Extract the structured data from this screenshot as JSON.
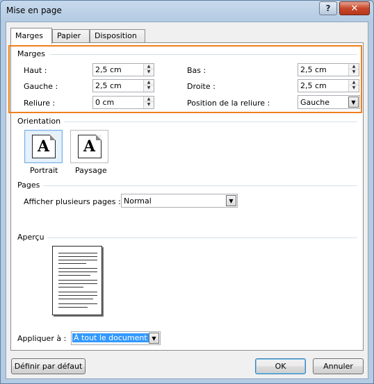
{
  "window": {
    "title": "Mise en page",
    "help_glyph": "?",
    "close_glyph": "✕"
  },
  "tabs": [
    {
      "label": "Marges",
      "active": true
    },
    {
      "label": "Papier",
      "active": false
    },
    {
      "label": "Disposition",
      "active": false
    }
  ],
  "margins": {
    "group_label": "Marges",
    "top": {
      "label": "Haut :",
      "value": "2,5 cm"
    },
    "left": {
      "label": "Gauche :",
      "value": "2,5 cm"
    },
    "gutter": {
      "label": "Reliure :",
      "value": "0 cm"
    },
    "bottom": {
      "label": "Bas :",
      "value": "2,5 cm"
    },
    "right": {
      "label": "Droite :",
      "value": "2,5 cm"
    },
    "gutter_position": {
      "label": "Position de la reliure :",
      "value": "Gauche"
    }
  },
  "orientation": {
    "group_label": "Orientation",
    "portrait": {
      "label": "Portrait",
      "selected": true
    },
    "landscape": {
      "label": "Paysage",
      "selected": false
    },
    "icon_glyph": "A"
  },
  "pages": {
    "group_label": "Pages",
    "multiple_pages_label": "Afficher plusieurs pages :",
    "multiple_pages_value": "Normal"
  },
  "preview": {
    "group_label": "Aperçu",
    "apply_label": "Appliquer à :",
    "apply_value": "À tout le document"
  },
  "buttons": {
    "default": "Définir par défaut",
    "ok": "OK",
    "cancel": "Annuler"
  },
  "colors": {
    "highlight": "#f07f1d",
    "selection": "#3399ff"
  }
}
